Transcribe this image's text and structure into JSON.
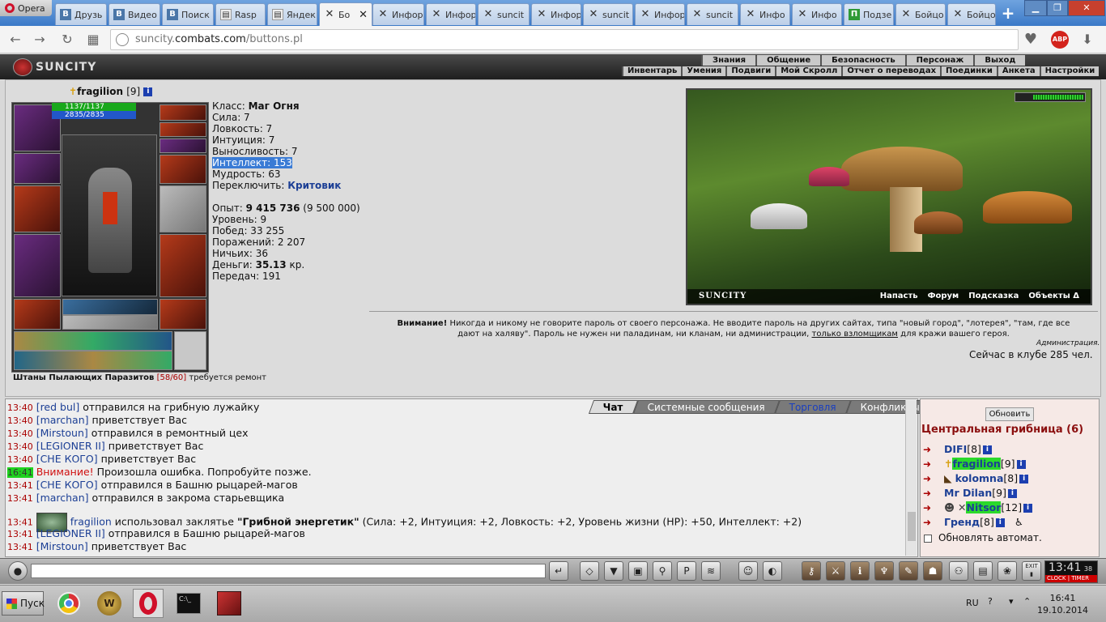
{
  "browser": {
    "app_label": "Opera",
    "tabs": [
      {
        "label": "Друзь",
        "icon": "vk-icon"
      },
      {
        "label": "Видео",
        "icon": "vk-icon"
      },
      {
        "label": "Поиск",
        "icon": "vk-icon"
      },
      {
        "label": "Rasp",
        "icon": "page-icon"
      },
      {
        "label": "Яндек",
        "icon": "page-icon"
      },
      {
        "label": "Бо",
        "icon": "combats-icon",
        "active": true
      },
      {
        "label": "Инфор",
        "icon": "combats-icon"
      },
      {
        "label": "Инфор",
        "icon": "combats-icon"
      },
      {
        "label": "suncit",
        "icon": "combats-icon"
      },
      {
        "label": "Инфор",
        "icon": "combats-icon"
      },
      {
        "label": "suncit",
        "icon": "combats-icon"
      },
      {
        "label": "Инфор",
        "icon": "combats-icon"
      },
      {
        "label": "suncit",
        "icon": "combats-icon"
      },
      {
        "label": "Инфо",
        "icon": "combats-icon"
      },
      {
        "label": "Инфо",
        "icon": "combats-icon"
      },
      {
        "label": "Подзе",
        "icon": "p-icon"
      },
      {
        "label": "Бойцо",
        "icon": "combats-icon"
      },
      {
        "label": "Бойцо",
        "icon": "combats-icon"
      }
    ],
    "url_prefix": "suncity.",
    "url_domain": "combats.com",
    "url_path": "/buttons.pl",
    "abp_badge": "ABP"
  },
  "game": {
    "logo": "SUNCITY",
    "menu_top": [
      "Знания",
      "Общение",
      "Безопасность",
      "Персонаж",
      "Выход"
    ],
    "menu_sub": [
      "Инвентарь",
      "Умения",
      "Подвиги",
      "Мой Скролл",
      "Отчет о переводах",
      "Поединки",
      "Анкета",
      "Настройки"
    ]
  },
  "character": {
    "name": "fragilion",
    "level": "[9]",
    "hp": "1137/1137",
    "mp": "2835/2835",
    "item_note_name": "Штаны Пылающих Паразитов",
    "item_note_durability": "[58/60]",
    "item_note_status": "требуется ремонт"
  },
  "stats": {
    "class_label": "Класс:",
    "class_value": "Маг Огня",
    "strength": "Сила: 7",
    "agility": "Ловкость: 7",
    "intuition": "Интуиция: 7",
    "stamina": "Выносливость: 7",
    "intellect": "Интеллект: 153",
    "wisdom": "Мудрость: 63",
    "switch_label": "Переключить:",
    "switch_value": "Критовик",
    "exp_label": "Опыт:",
    "exp_value": "9 415 736",
    "exp_next": "(9 500 000)",
    "level": "Уровень: 9",
    "wins": "Побед: 33 255",
    "losses": "Поражений: 2 207",
    "draws": "Ничьих: 36",
    "money_label": "Деньги:",
    "money_value": "35.13",
    "money_unit": "кр.",
    "transfers": "Передач: 191"
  },
  "scene": {
    "logo": "SUNCITY",
    "links": [
      "Напасть",
      "Форум",
      "Подсказка",
      "Объекты Δ"
    ]
  },
  "warning": {
    "title": "Внимание!",
    "text1": "Никогда и никому не говорите пароль от своего персонажа. Не вводите пароль на других сайтах, типа \"новый город\", \"лотерея\", \"там, где все",
    "text2": "дают на халяву\". Пароль не нужен ни паладинам, ни кланам, ни администрации,",
    "link": "только взломщикам",
    "text3": "для кражи вашего героя.",
    "signature": "Администрация.",
    "online": "Сейчас в клубе 285 чел."
  },
  "chat": {
    "tabs": [
      "Чат",
      "Системные сообщения",
      "Торговля",
      "Конфликты"
    ],
    "lines": [
      {
        "time": "13:40",
        "user": "[red bul]",
        "text": "отправился на грибную лужайку"
      },
      {
        "time": "13:40",
        "user": "[marchan]",
        "text": "приветствует Вас"
      },
      {
        "time": "13:40",
        "user": "[Mirstoun]",
        "text": "отправился в ремонтный цех"
      },
      {
        "time": "13:40",
        "user": "[LEGIONER II]",
        "text": "приветствует Вас"
      },
      {
        "time": "13:40",
        "user": "[СНЕ КОГО]",
        "text": "приветствует Вас"
      },
      {
        "time": "16:41",
        "user": "Внимание!",
        "text": "Произошла ошибка. Попробуйте позже."
      },
      {
        "time": "13:41",
        "user": "[СНЕ КОГО]",
        "text": "отправился в Башню рыцарей-магов"
      },
      {
        "time": "13:41",
        "user": "[marchan]",
        "text": "отправился в закрома старьевщика"
      },
      {
        "time": "13:41",
        "user": "fragilion",
        "text": "использовал заклятье",
        "spell": "\"Грибной энергетик\"",
        "effect": "(Сила: +2, Интуиция: +2, Ловкость: +2, Уровень жизни (HP): +50, Интеллект: +2)"
      },
      {
        "time": "13:41",
        "user": "[LEGIONER II]",
        "text": "отправился в Башню рыцарей-магов"
      },
      {
        "time": "13:41",
        "user": "[Mirstoun]",
        "text": "приветствует Вас"
      }
    ]
  },
  "room": {
    "refresh_label": "Обновить",
    "title": "Центральная грибница (6)",
    "players": [
      {
        "name": "DIFI",
        "level": "[8]"
      },
      {
        "name": "fragilion",
        "level": "[9]"
      },
      {
        "name": "kolomna",
        "level": "[8]"
      },
      {
        "name": "Mr Dilan",
        "level": "[9]"
      },
      {
        "name": "Nitsor",
        "level": "[12]"
      },
      {
        "name": "Гренд",
        "level": "[8]"
      }
    ],
    "auto_update": "Обновлять автомат."
  },
  "clock": {
    "time": "13:41",
    "seconds": "38",
    "label_clock": "CLOCK",
    "label_timer": "TIMER",
    "exit": "EXIT"
  },
  "taskbar": {
    "start": "Пуск",
    "lang": "RU",
    "time": "16:41",
    "date": "19.10.2014"
  }
}
